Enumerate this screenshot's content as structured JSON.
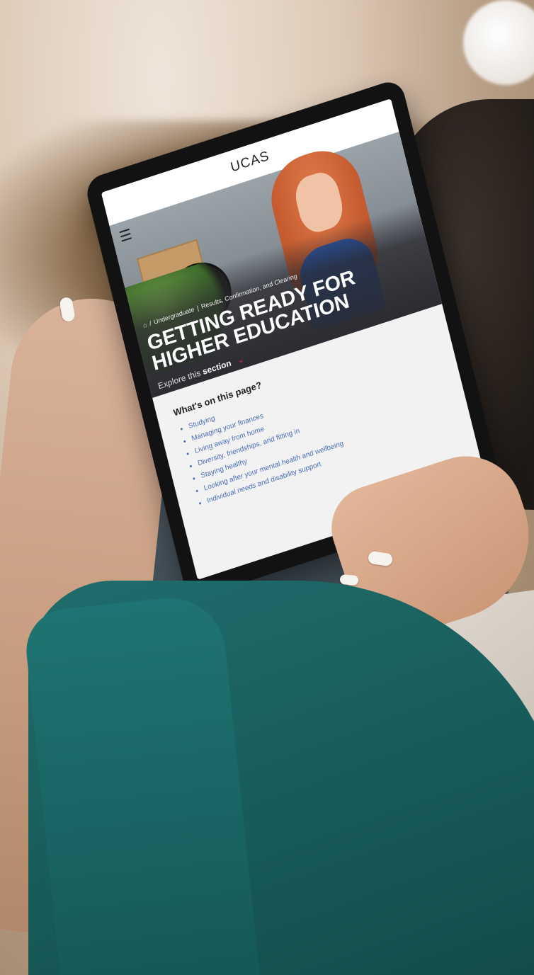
{
  "tablet_screen": {
    "logo": "UCAS",
    "menu_icon": "hamburger-icon",
    "breadcrumb": {
      "home_icon": "home-icon",
      "items": [
        "Undergraduate",
        "Results, Confirmation, and Clearing"
      ]
    },
    "title": "GETTING READY FOR HIGHER EDUCATION",
    "explore": {
      "prefix": "Explore this",
      "strong": "section"
    },
    "explore_icon": "chevron-down-icon",
    "on_this_page": {
      "heading": "What's on this page?",
      "links": [
        "Studying",
        "Managing your finances",
        "Living away from home",
        "Diversity, friendships, and fitting in",
        "Staying healthy",
        "Looking after your mental health and wellbeing",
        "Individual needs and disability support"
      ]
    }
  },
  "colors": {
    "accent": "#e0245e",
    "link": "#4a6fb5",
    "sweater": "#1f6d6b"
  }
}
